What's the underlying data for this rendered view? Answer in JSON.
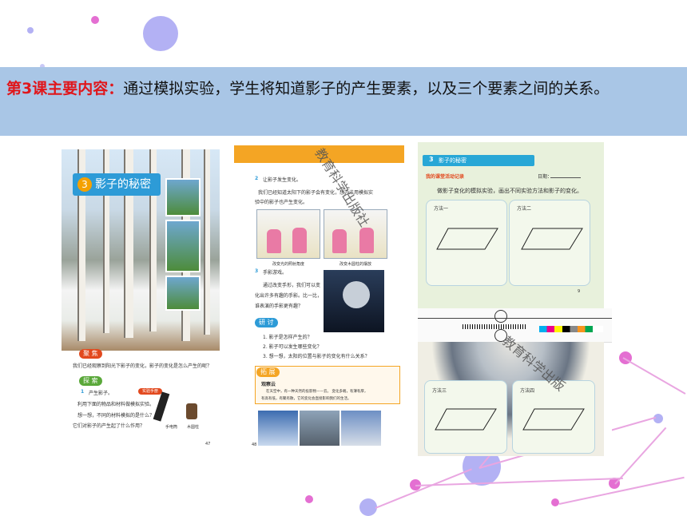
{
  "banner": {
    "highlight": "第3课主要内容：",
    "text": "通过模拟实验，学生将知道影子的产生要素，以及三个要素之间的关系。"
  },
  "colors": {
    "banner_bg": "#a9c6e6",
    "highlight": "#e0161b",
    "decor_purple": "#b3b1f4",
    "decor_pink": "#e46fd2"
  },
  "watermark": "教育科学出版社",
  "watermark2": "教育科学出版",
  "textbook_left": {
    "lesson_number": "3",
    "lesson_title": "影子的秘密",
    "focus_tag": "聚 焦",
    "focus_text": "我们已经观察到阳光下影子的变化，影子的变化是怎么产生的呢？",
    "explore_tag": "探 索",
    "step1_num": "1",
    "step1": "产生影子。",
    "step1_tag": "实验手册",
    "line_a": "利用下面的物品和材料做模拟实验。",
    "line_b": "想一想，不同的材料模拟的是什么？",
    "line_c": "它们对影子的产生起了什么作用？",
    "item1": "手电筒",
    "item2": "木圆柱",
    "page": "47"
  },
  "textbook_right": {
    "step2_num": "2",
    "step2": "让影子发生变化。",
    "step2_text_a": "我们已经知道太阳下的影子会有变化，想办法用模拟实",
    "step2_text_b": "验中的影子也产生变化。",
    "cap1": "改变光的照射角度",
    "cap2": "改变木圆柱的摆放",
    "step3_num": "3",
    "step3": "手影游戏。",
    "step3_text_a": "通过改变手形，我们可以变",
    "step3_text_b": "化出许多有趣的手影。比一比，",
    "step3_text_c": "谁表演的手影更有趣？",
    "research_tag": "研 讨",
    "q1": "1. 影子是怎样产生的？",
    "q2": "2. 影子可以发生哪些变化？",
    "q3": "3. 想一想，太阳的位置与影子的变化有什么关系？",
    "expand_tag": "拓 展",
    "expand_title": "观察云",
    "expand_text_a": "在天空中，有一种天然的投影物——云。 变化多端，有薄有厚，",
    "expand_text_b": "有高有低，有聚有散，它的变化会直接影响我们的生活。",
    "page": "48"
  },
  "workbook": {
    "lesson_number": "3",
    "title": "影子的秘密",
    "subtitle": "我的课堂活动记录",
    "date_label": "日期：",
    "instruction": "做影子变化的模拟实验，画出不同实验方法和影子的变化。",
    "method1": "方法一",
    "method2": "方法二",
    "method3": "方法三",
    "method4": "方法四",
    "page": "9"
  }
}
